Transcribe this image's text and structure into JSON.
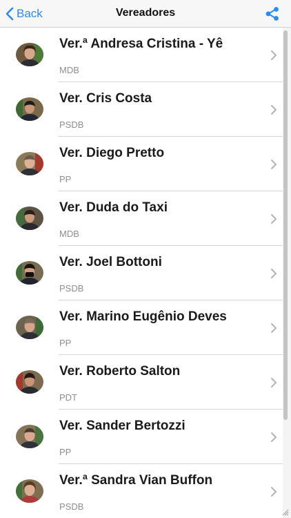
{
  "header": {
    "back_label": "Back",
    "title": "Vereadores",
    "back_icon": "chevron-left-icon",
    "share_icon": "share-icon",
    "accent_color": "#2a8bf2"
  },
  "councilors": [
    {
      "name": "Ver.ª Andresa Cristina - Yê",
      "party": "MDB"
    },
    {
      "name": "Ver. Cris Costa",
      "party": "PSDB"
    },
    {
      "name": "Ver. Diego Pretto",
      "party": "PP"
    },
    {
      "name": "Ver. Duda do Taxi",
      "party": "MDB"
    },
    {
      "name": "Ver. Joel Bottoni",
      "party": "PSDB"
    },
    {
      "name": "Ver. Marino Eugênio Deves",
      "party": "PP"
    },
    {
      "name": "Ver. Roberto Salton",
      "party": "PDT"
    },
    {
      "name": "Ver. Sander Bertozzi",
      "party": "PP"
    },
    {
      "name": "Ver.ª Sandra Vian Buffon",
      "party": "PSDB"
    }
  ]
}
